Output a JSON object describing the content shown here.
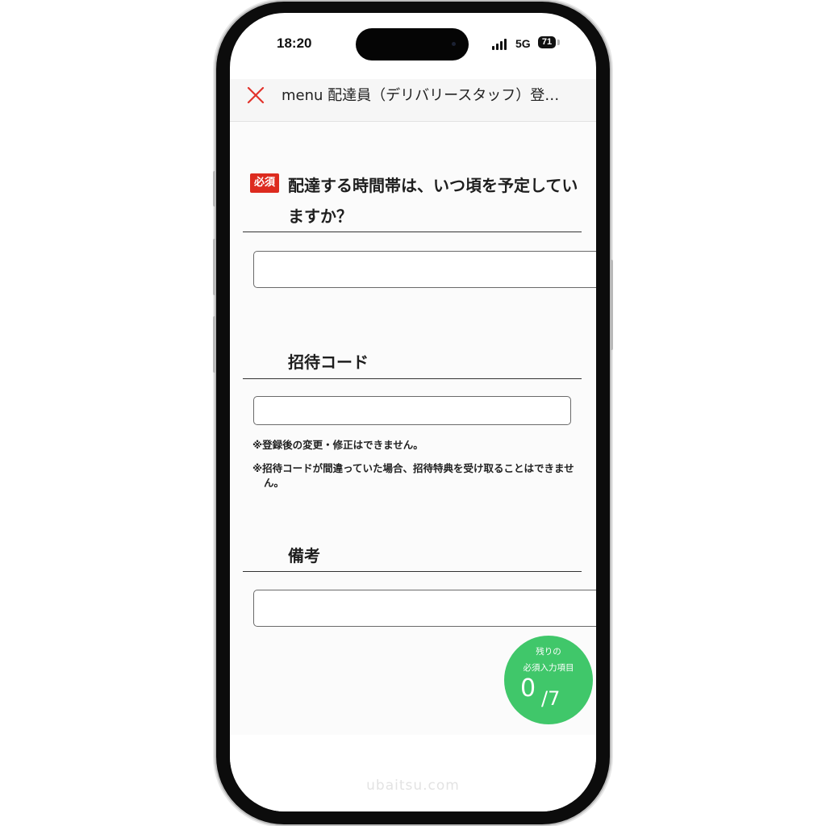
{
  "status_bar": {
    "time": "18:20",
    "network": "5G",
    "battery": "71"
  },
  "header": {
    "title": "menu 配達員（デリバリースタッフ）登…",
    "close_icon": "close-icon",
    "close_color": "#e2332b"
  },
  "form": {
    "delivery_time": {
      "badge": "必須",
      "title": "配達する時間帯は、いつ頃を予定していますか？",
      "value": ""
    },
    "invite_code": {
      "title": "招待コード",
      "value": "",
      "notes": [
        "※登録後の変更・修正はできません。",
        "※招待コードが間違っていた場合、招待特典を受け取ることはできません。"
      ]
    },
    "remarks": {
      "title": "備考",
      "value": ""
    }
  },
  "counter": {
    "label_line1": "残りの",
    "label_line2": "必須入力項目",
    "remaining": "0",
    "total": "/7",
    "color": "#40c76a"
  },
  "watermark": "ubaitsu.com",
  "colors": {
    "required_badge": "#dd2b1f"
  }
}
